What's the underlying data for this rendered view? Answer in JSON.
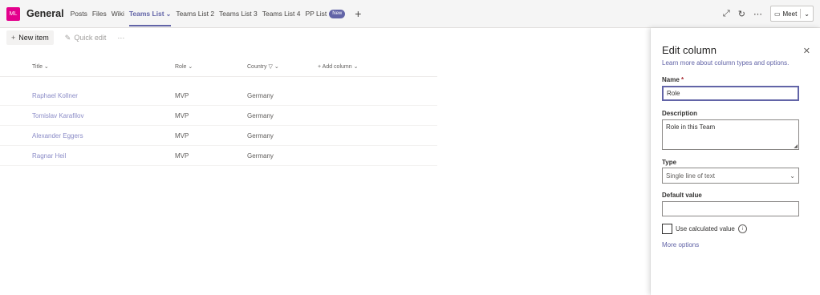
{
  "header": {
    "avatar": "ML",
    "channel": "General",
    "tabs": [
      {
        "label": "Posts"
      },
      {
        "label": "Files"
      },
      {
        "label": "Wiki"
      },
      {
        "label": "Teams List"
      },
      {
        "label": "Teams List 2"
      },
      {
        "label": "Teams List 3"
      },
      {
        "label": "Teams List 4"
      },
      {
        "label": "PP List"
      }
    ],
    "badge": "New",
    "meet": "Meet"
  },
  "toolbar": {
    "new_item": "New item",
    "quick_edit": "Quick edit"
  },
  "grid": {
    "columns": [
      "Title",
      "Role",
      "Country",
      "+ Add column"
    ],
    "rows": [
      {
        "title": "Raphael Kollner",
        "role": "MVP",
        "country": "Germany"
      },
      {
        "title": "Tomislav Karafilov",
        "role": "MVP",
        "country": "Germany"
      },
      {
        "title": "Alexander Eggers",
        "role": "MVP",
        "country": "Germany"
      },
      {
        "title": "Ragnar Heil",
        "role": "MVP",
        "country": "Germany"
      }
    ]
  },
  "panel": {
    "title": "Edit column",
    "learn_link": "Learn more about column types and options.",
    "name_label": "Name",
    "name_value": "Role",
    "description_label": "Description",
    "description_value": "Role in this Team",
    "type_label": "Type",
    "type_value": "Single line of text",
    "default_label": "Default value",
    "default_value": "",
    "calc_label": "Use calculated value",
    "more_options": "More options"
  }
}
